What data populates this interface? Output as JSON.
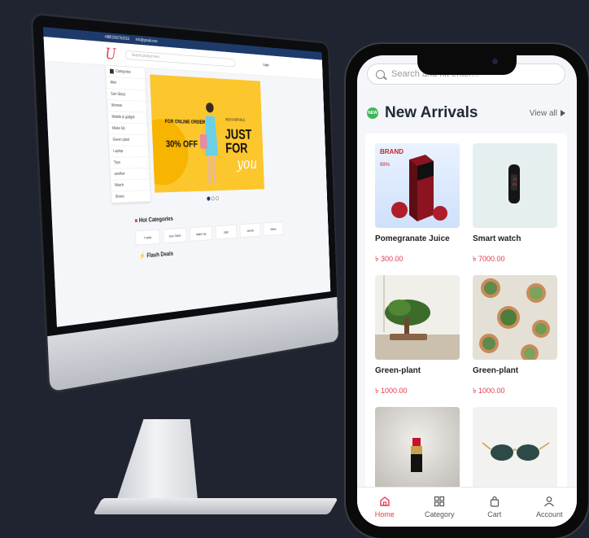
{
  "desktop": {
    "topbar": {
      "phone": "+8801552762015",
      "email": "info@gmail.com"
    },
    "logo": "U",
    "search": {
      "placeholder": "Search product here"
    },
    "categories_button": "Categories",
    "sidebar": [
      "Men",
      "Sun Glass",
      "Women",
      "Mobile & gadget",
      "Make Up",
      "Green plant",
      "Laptop",
      "Toys",
      "another",
      "Watch",
      "Shoes"
    ],
    "banner": {
      "for_online_order": "FOR ONLINE ORDER",
      "discount": "30% OFF",
      "new_arrivals": "NEW ARRIVALS",
      "just_for": "JUST FOR",
      "you": "you"
    },
    "hot_categories_title": "Hot Categories",
    "hot_categories": [
      "T-shirt",
      "Sun Glass",
      "Make Up",
      "Shirt",
      "Watch",
      "Shoes"
    ],
    "flash_deals_title": "Flash Deals",
    "login": "Login"
  },
  "mobile": {
    "search": {
      "placeholder": "Search and hit enter..."
    },
    "section_badge": "NEW",
    "section_title": "New Arrivals",
    "view_all": "View all",
    "products": [
      {
        "name": "Pomegranate Juice",
        "price": "৳ 300.00",
        "image_icon": "juice-box-icon",
        "brand": "BRAND",
        "brand_sub": "99%"
      },
      {
        "name": "Smart watch",
        "price": "৳ 7000.00",
        "image_icon": "smartwatch-icon"
      },
      {
        "name": "Green-plant",
        "price": "৳ 1000.00",
        "image_icon": "bonsai-icon"
      },
      {
        "name": "Green-plant",
        "price": "৳ 1000.00",
        "image_icon": "succulents-icon"
      },
      {
        "name": "",
        "price": "",
        "image_icon": "lipstick-icon"
      },
      {
        "name": "",
        "price": "",
        "image_icon": "sunglasses-icon"
      }
    ],
    "tabs": [
      {
        "label": "Home",
        "icon": "home-icon",
        "active": true
      },
      {
        "label": "Category",
        "icon": "grid-icon",
        "active": false
      },
      {
        "label": "Cart",
        "icon": "bag-icon",
        "active": false
      },
      {
        "label": "Account",
        "icon": "user-icon",
        "active": false
      }
    ]
  },
  "colors": {
    "accent": "#e23b4e",
    "navy": "#1e3a6b",
    "banner": "#fcc62d",
    "new_badge": "#3cb85a"
  }
}
